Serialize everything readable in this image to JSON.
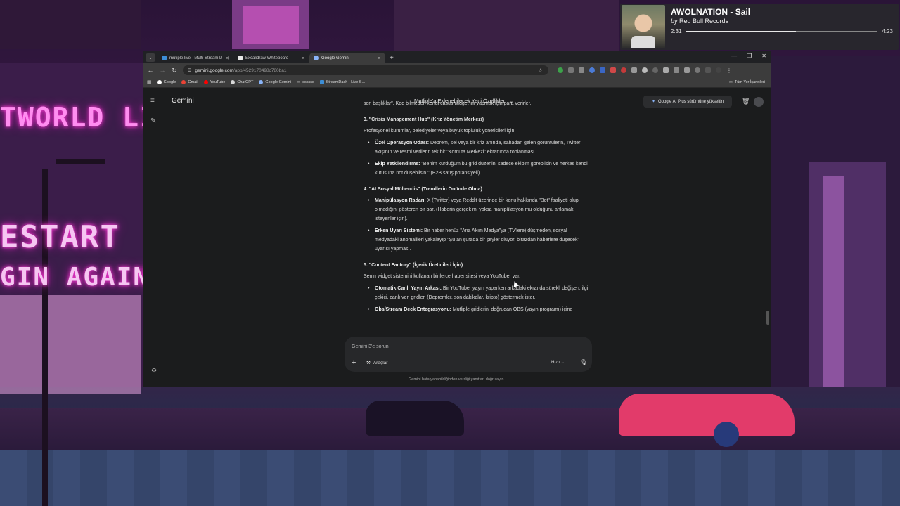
{
  "media": {
    "title": "AWOLNATION - Sail",
    "by_prefix": "by",
    "artist": "Red Bull Records",
    "elapsed": "2:31",
    "duration": "4:23",
    "progress": 0.574
  },
  "browser": {
    "tabs": [
      {
        "label": "mutiple.live - Multi-Stream Da",
        "active": false,
        "favicon_color": "#3d8ed6"
      },
      {
        "label": "Excalidraw Whiteboard",
        "active": false,
        "favicon_color": "#e8e8e8"
      },
      {
        "label": "Google Gemini",
        "active": true,
        "favicon_color": "#8ab4f8"
      }
    ],
    "new_tab": "+",
    "url_host": "gemini.google.com",
    "url_path": "/app/4529170498c780ba1",
    "bookmarks": [
      {
        "label": "Google",
        "color": "#ffffff"
      },
      {
        "label": "Gmail",
        "color": "#ea4335"
      },
      {
        "label": "YouTube",
        "color": "#ff0000"
      },
      {
        "label": "ChatGPT",
        "color": "#d8d8d8"
      },
      {
        "label": "Google Gemini",
        "color": "#8ab4f8"
      },
      {
        "label": "ssssss",
        "color": "#888888"
      },
      {
        "label": "StreamDash - Live S...",
        "color": "#3d8ed6"
      }
    ],
    "all_bookmarks": "Tüm Yer İşaretleri"
  },
  "gemini": {
    "logo": "Gemini",
    "conversation_title": "Mutliple'a Eklenebilecek Yeni Özellikler",
    "upgrade": "Google AI Plus sürümüne yükseltin",
    "blocks": [
      {
        "kind": "text",
        "text": "son başlıklar\". Kod bilmeden kendi casus widget'ını yapmak için para verirler."
      },
      {
        "kind": "heading",
        "text": "3. \"Crisis Management Hub\" (Kriz Yönetim Merkezi)"
      },
      {
        "kind": "text",
        "text": "Profesyonel kurumlar, belediyeler veya büyük topluluk yöneticileri için:"
      },
      {
        "kind": "item",
        "bold": "Özel Operasyon Odası:",
        "text": "Deprem, sel veya bir kriz anında, sahadan gelen görüntülerin, Twitter akışının ve resmi verilerin tek bir \"Komuta Merkezi\" ekranında toplanması."
      },
      {
        "kind": "item",
        "bold": "Ekip Yetkilendirme:",
        "text": "\"Benim kurduğum bu grid düzenini sadece ekibim görebilsin ve herkes kendi kutusuna not düşebilsin.\" (B2B satış potansiyeli)."
      },
      {
        "kind": "heading",
        "text": "4. \"AI Sosyal Mühendis\" (Trendlerin Önünde Olma)"
      },
      {
        "kind": "item",
        "bold": "Manipülasyon Radarı:",
        "text": "X (Twitter) veya Reddit üzerinde bir konu hakkında \"Bot\" faaliyeti olup olmadığını gösteren bir bar. (Haberin gerçek mi yoksa manipülasyon mu olduğunu anlamak isteyenler için)."
      },
      {
        "kind": "item",
        "bold": "Erken Uyarı Sistemi:",
        "text": "Bir haber henüz \"Ana Akım Medya\"ya (TV'lere) düşmeden, sosyal medyadaki anomalileri yakalayıp \"Şu an şurada bir şeyler oluyor, birazdan haberlere düşecek\" uyarısı yapması."
      },
      {
        "kind": "heading",
        "text": "5. \"Content Factory\" (İçerik Üreticileri İçin)"
      },
      {
        "kind": "text",
        "text": "Senin widget sistemini kullanan binlerce haber sitesi veya YouTuber var."
      },
      {
        "kind": "item",
        "bold": "Otomatik Canlı Yayın Arkası:",
        "text": "Bir YouTuber yayın yaparken arkadaki ekranda sürekli değişen, ilgi çekici, canlı veri gridleri (Depremler, son dakikalar, kripto) göstermek ister."
      },
      {
        "kind": "item",
        "bold": "Obs/Stream Deck Entegrasyonu:",
        "text": "Mutliple gridlerini doğrudan OBS (yayın programı) içine"
      }
    ],
    "composer_placeholder": "Gemini 3'e sorun",
    "tools_label": "Araçlar",
    "mode_label": "Hızlı",
    "disclaimer": "Gemini hata yapabildiğinden verdiği yanıtları doğrulayın."
  },
  "wallpaper": {
    "sign_world": "TWORLD LI",
    "sign_restart": "ESTART",
    "sign_again": "GIN AGAIN"
  }
}
